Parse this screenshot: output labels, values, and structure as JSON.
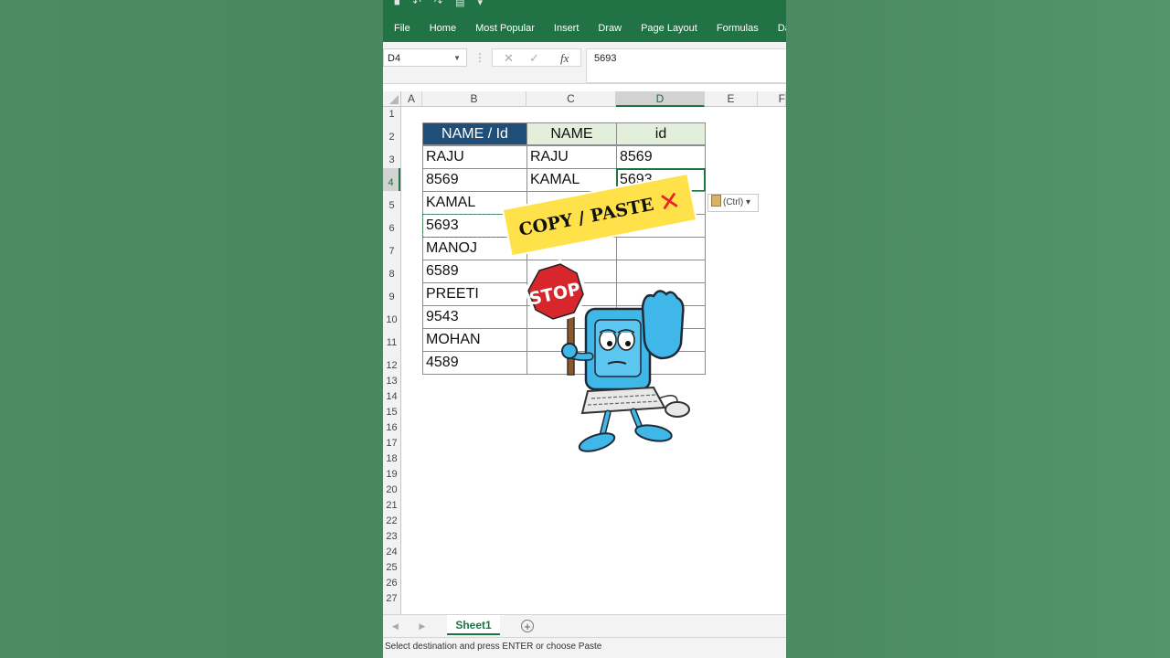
{
  "ribbon": {
    "tabs": [
      "File",
      "Home",
      "Most Popular",
      "Insert",
      "Draw",
      "Page Layout",
      "Formulas",
      "Dat"
    ]
  },
  "formula_bar": {
    "name_box": "D4",
    "fx_label": "fx",
    "value": "5693"
  },
  "columns": [
    "A",
    "B",
    "C",
    "D",
    "E",
    "F"
  ],
  "rows": [
    "1",
    "2",
    "3",
    "4",
    "5",
    "6",
    "7",
    "8",
    "9",
    "10",
    "11",
    "12",
    "13",
    "14",
    "15",
    "16",
    "17",
    "18",
    "19",
    "20",
    "21",
    "22",
    "23",
    "24",
    "25",
    "26",
    "27"
  ],
  "table": {
    "header_b": "NAME / Id",
    "header_c": "NAME",
    "header_d": "id",
    "col_b": [
      "RAJU",
      "8569",
      "KAMAL",
      "5693",
      "MANOJ",
      "6589",
      "PREETI",
      "9543",
      "MOHAN",
      "4589"
    ],
    "col_c": [
      "RAJU",
      "KAMAL",
      "",
      "",
      "",
      "",
      "",
      "",
      "",
      ""
    ],
    "col_d": [
      "8569",
      "5693",
      "",
      "",
      "",
      "",
      "",
      "",
      "",
      ""
    ]
  },
  "paste_options": "(Ctrl)",
  "overlay": {
    "banner_text": "COPY / PASTE",
    "banner_mark": "✕",
    "stop_sign": "STOP"
  },
  "sheet_tab": "Sheet1",
  "add_sheet": "+",
  "status_text": "Select destination and press ENTER or choose Paste",
  "colors": {
    "ribbon": "#217346",
    "header_dark": "#1f4e79",
    "header_light": "#e2efda",
    "banner": "#ffe24a",
    "stop_red": "#d7262c"
  }
}
